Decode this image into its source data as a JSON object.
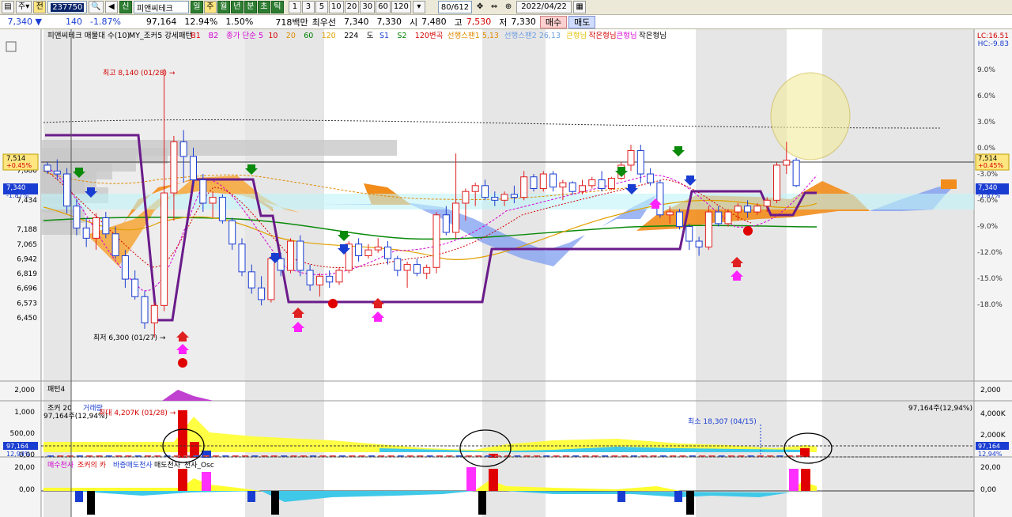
{
  "toolbar": {
    "period_label": "주",
    "all_label": "전",
    "code": "237750",
    "new_badge": "신",
    "stock_name": "피앤씨테크",
    "period_tabs": [
      "일",
      "주",
      "월",
      "년",
      "분",
      "초",
      "틱"
    ],
    "active_period_index": 1,
    "number_tabs": [
      "1",
      "3",
      "5",
      "10",
      "20",
      "30",
      "60",
      "120"
    ],
    "count_value": "80",
    "count_total": "/612",
    "date": "2022/04/22"
  },
  "quote": {
    "price": "7,340",
    "change": "140",
    "change_pct": "-1.87%",
    "volume": "97,164",
    "turnover_pct": "12.94%",
    "vol_ratio": "1.50%",
    "amount": "718백만",
    "best_ask_label": "최우선",
    "best_ask": "7,340",
    "best_bid": "7,330",
    "open_label": "시",
    "open": "7,480",
    "high_label": "고",
    "high": "7,530",
    "low_label": "저",
    "low": "7,330",
    "buy_label": "매수",
    "sell_label": "매도"
  },
  "legend_top": [
    {
      "text": "피앤씨테크 매물대 수(10)",
      "color": "#000000"
    },
    {
      "text": "MY_조커5 강세패턴",
      "color": "#000000"
    },
    {
      "text": "B1",
      "color": "#d40000"
    },
    {
      "text": "B2",
      "color": "#d400d4"
    },
    {
      "text": "종가 단순 5",
      "color": "#d400d4"
    },
    {
      "text": "10",
      "color": "#d40000"
    },
    {
      "text": "20",
      "color": "#e08a00"
    },
    {
      "text": "60",
      "color": "#008000"
    },
    {
      "text": "120",
      "color": "#e0a000"
    },
    {
      "text": "224",
      "color": "#000000"
    },
    {
      "text": "도",
      "color": "#000000"
    },
    {
      "text": "S1",
      "color": "#1a3dd1"
    },
    {
      "text": "S2",
      "color": "#008000"
    },
    {
      "text": "120변곡",
      "color": "#d40000"
    },
    {
      "text": "선행스팬1 5,13",
      "color": "#e08a00"
    },
    {
      "text": "선행스팬2 26,13",
      "color": "#6fa0e0"
    },
    {
      "text": "큰형님",
      "color": "#e0c000"
    },
    {
      "text": "작은형님",
      "color": "#d40000"
    },
    {
      "text": "큰형님",
      "color": "#d400d4"
    },
    {
      "text": "작은형님",
      "color": "#000000"
    }
  ],
  "price_labels": [
    "7,680",
    "7,434",
    "7,188",
    "7,065",
    "6,942",
    "6,819",
    "6,696",
    "6,573",
    "6,450"
  ],
  "pct_axis": [
    "9.0%",
    "6.0%",
    "3.0%",
    "0.0%",
    "-3.0%",
    "-6.0%",
    "-9.0%",
    "-12.0%",
    "-15.0%",
    "-18.0%"
  ],
  "top_right": {
    "lc": "LC:16.51",
    "hc": "HC:-9.83"
  },
  "current_tag": {
    "price": "7,514",
    "pct": "+0.45%"
  },
  "close_tag": {
    "price": "7,340",
    "pct": "-1.87%"
  },
  "annotations": {
    "max": "최고 8,140 (01/28)",
    "min": "최저 6,300 (01/27)"
  },
  "panel_pattern": {
    "title": "패턴4",
    "axis": "2,000"
  },
  "panel_volume": {
    "title": "조커 20",
    "title2": "거래량",
    "current": "97,164주(12,94%)",
    "max_label": "최대 4,207K (01/28)",
    "min_label": "최소 18,307 (04/15)",
    "right_value": "97,164주(12,94%)",
    "axis_left": [
      "1,000",
      "500,00",
      "0,00"
    ],
    "axis_right": [
      "4,000K",
      "2,000K"
    ],
    "tag_value": "97,164",
    "tag_pct": "12,94%"
  },
  "panel_osc": {
    "legend": [
      {
        "text": "매수천사",
        "color": "#d400d4"
      },
      {
        "text": "조커의 카",
        "color": "#d40000"
      },
      {
        "text": "바증매도천사",
        "color": "#1a3dd1"
      },
      {
        "text": "매도천사",
        "color": "#000000"
      },
      {
        "text": "천사_Osc",
        "color": "#000000"
      }
    ],
    "axis_left": [
      "20,00",
      "0,00"
    ],
    "axis_right": [
      "20,00",
      "0,00"
    ]
  },
  "chart_data": {
    "type": "candlestick",
    "candles": [
      [
        7480,
        7500,
        7420,
        7440
      ],
      [
        7440,
        7520,
        7380,
        7420
      ],
      [
        7420,
        7460,
        7150,
        7200
      ],
      [
        7200,
        7250,
        7000,
        7050
      ],
      [
        7050,
        7120,
        6920,
        6980
      ],
      [
        6980,
        7150,
        6900,
        7120
      ],
      [
        7120,
        7160,
        6980,
        7010
      ],
      [
        7010,
        7060,
        6840,
        6860
      ],
      [
        6860,
        6900,
        6640,
        6700
      ],
      [
        6700,
        6760,
        6560,
        6580
      ],
      [
        6580,
        6620,
        6360,
        6400
      ],
      [
        6400,
        6540,
        6300,
        6520
      ],
      [
        6520,
        8140,
        6480,
        7290
      ],
      [
        7290,
        7680,
        7100,
        7640
      ],
      [
        7640,
        7720,
        7360,
        7540
      ],
      [
        7540,
        7600,
        7340,
        7380
      ],
      [
        7380,
        7420,
        7160,
        7220
      ],
      [
        7220,
        7300,
        7120,
        7260
      ],
      [
        7260,
        7280,
        7080,
        7100
      ],
      [
        7100,
        7120,
        6900,
        6940
      ],
      [
        6940,
        6980,
        6720,
        6750
      ],
      [
        6750,
        6800,
        6600,
        6640
      ],
      [
        6640,
        6720,
        6520,
        6560
      ],
      [
        6560,
        6860,
        6540,
        6840
      ],
      [
        6840,
        6880,
        6720,
        6760
      ],
      [
        6760,
        6980,
        6740,
        6960
      ],
      [
        6960,
        7000,
        6720,
        6760
      ],
      [
        6760,
        6800,
        6620,
        6660
      ],
      [
        6660,
        6740,
        6580,
        6720
      ],
      [
        6720,
        6760,
        6640,
        6680
      ],
      [
        6680,
        6780,
        6660,
        6760
      ],
      [
        6760,
        6960,
        6740,
        6940
      ],
      [
        6940,
        6980,
        6820,
        6860
      ],
      [
        6860,
        6940,
        6840,
        6900
      ],
      [
        6900,
        6980,
        6880,
        6920
      ],
      [
        6920,
        6960,
        6800,
        6840
      ],
      [
        6840,
        6860,
        6720,
        6760
      ],
      [
        6760,
        6820,
        6640,
        6800
      ],
      [
        6800,
        6840,
        6720,
        6740
      ],
      [
        6740,
        6800,
        6700,
        6780
      ],
      [
        6780,
        7160,
        6740,
        7140
      ],
      [
        7140,
        7200,
        7000,
        7020
      ],
      [
        7020,
        7560,
        6980,
        7220
      ],
      [
        7220,
        7320,
        7100,
        7300
      ],
      [
        7300,
        7360,
        7200,
        7340
      ],
      [
        7340,
        7380,
        7240,
        7260
      ],
      [
        7260,
        7300,
        7200,
        7240
      ],
      [
        7240,
        7300,
        7200,
        7280
      ],
      [
        7280,
        7340,
        7220,
        7260
      ],
      [
        7260,
        7440,
        7240,
        7400
      ],
      [
        7400,
        7420,
        7300,
        7320
      ],
      [
        7320,
        7440,
        7300,
        7420
      ],
      [
        7420,
        7440,
        7300,
        7330
      ],
      [
        7330,
        7380,
        7240,
        7360
      ],
      [
        7360,
        7370,
        7280,
        7300
      ],
      [
        7300,
        7380,
        7280,
        7340
      ],
      [
        7340,
        7400,
        7320,
        7380
      ],
      [
        7380,
        7440,
        7300,
        7320
      ],
      [
        7320,
        7400,
        7310,
        7390
      ],
      [
        7390,
        7500,
        7380,
        7480
      ],
      [
        7480,
        7620,
        7440,
        7580
      ],
      [
        7580,
        7620,
        7360,
        7420
      ],
      [
        7420,
        7460,
        7340,
        7360
      ],
      [
        7360,
        7380,
        7120,
        7140
      ],
      [
        7140,
        7200,
        7080,
        7160
      ],
      [
        7160,
        7180,
        7040,
        7060
      ],
      [
        7060,
        7080,
        6900,
        6960
      ],
      [
        6960,
        6990,
        6860,
        6920
      ],
      [
        6920,
        7200,
        6900,
        7160
      ],
      [
        7160,
        7200,
        7060,
        7080
      ],
      [
        7080,
        7180,
        7060,
        7160
      ],
      [
        7160,
        7220,
        7100,
        7200
      ],
      [
        7200,
        7240,
        7120,
        7160
      ],
      [
        7160,
        7220,
        7140,
        7200
      ],
      [
        7200,
        7260,
        7160,
        7240
      ],
      [
        7240,
        7500,
        7220,
        7480
      ],
      [
        7480,
        7640,
        7420,
        7514
      ],
      [
        7514,
        7530,
        7330,
        7340
      ]
    ],
    "y_min": 6300,
    "y_max": 8140
  }
}
